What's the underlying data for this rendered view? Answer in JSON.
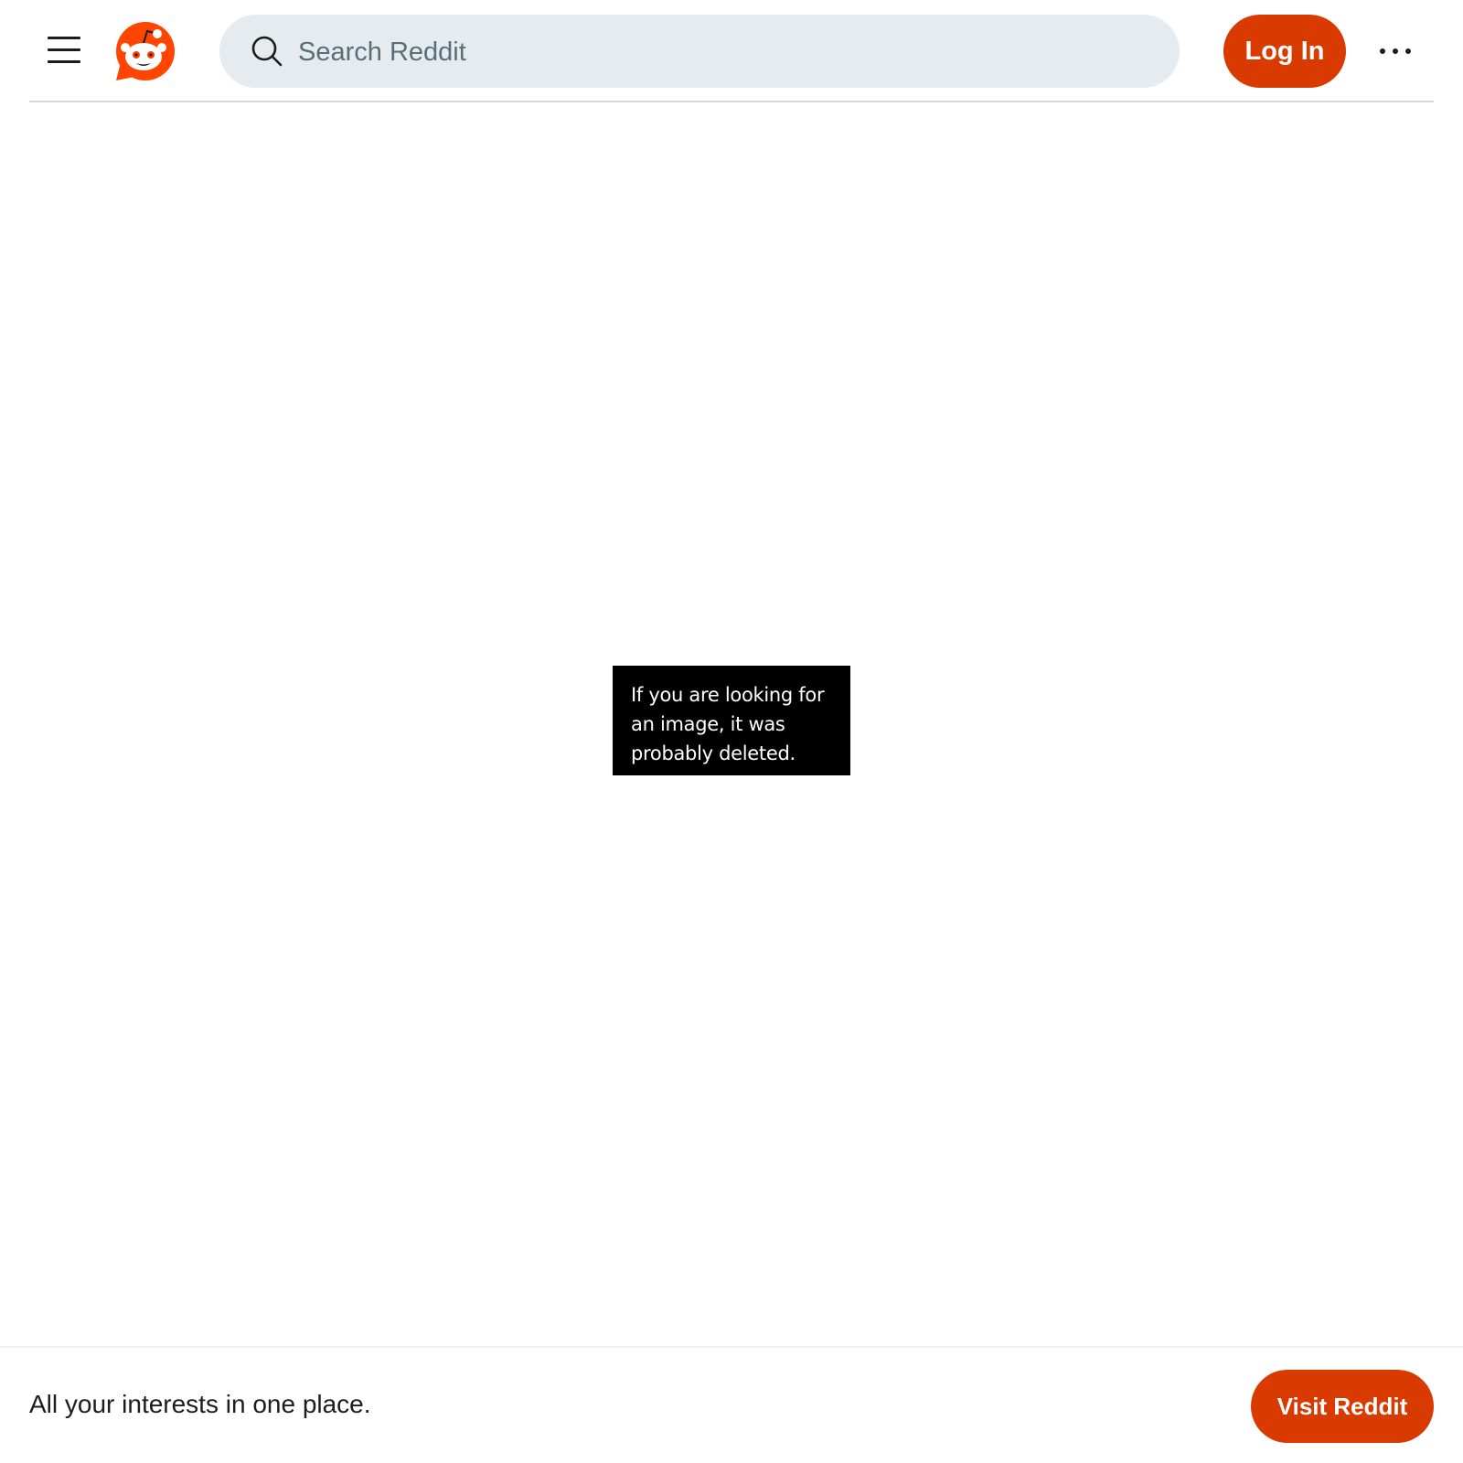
{
  "header": {
    "menu_icon": "hamburger-menu-icon",
    "logo_icon": "reddit-snoo-logo-icon",
    "search": {
      "icon": "search-icon",
      "placeholder": "Search Reddit"
    },
    "login_label": "Log In",
    "more_icon": "more-options-icon"
  },
  "main": {
    "notice_lines": [
      "If you are looking for",
      "an image, it was",
      "probably deleted."
    ]
  },
  "bottom_bar": {
    "tagline": "All your interests in one place.",
    "visit_label": "Visit Reddit"
  },
  "colors": {
    "brand_orange": "#d93a00",
    "logo_orange": "#ff4500",
    "search_bg": "#e5ebee",
    "text": "#1c1c1c"
  }
}
